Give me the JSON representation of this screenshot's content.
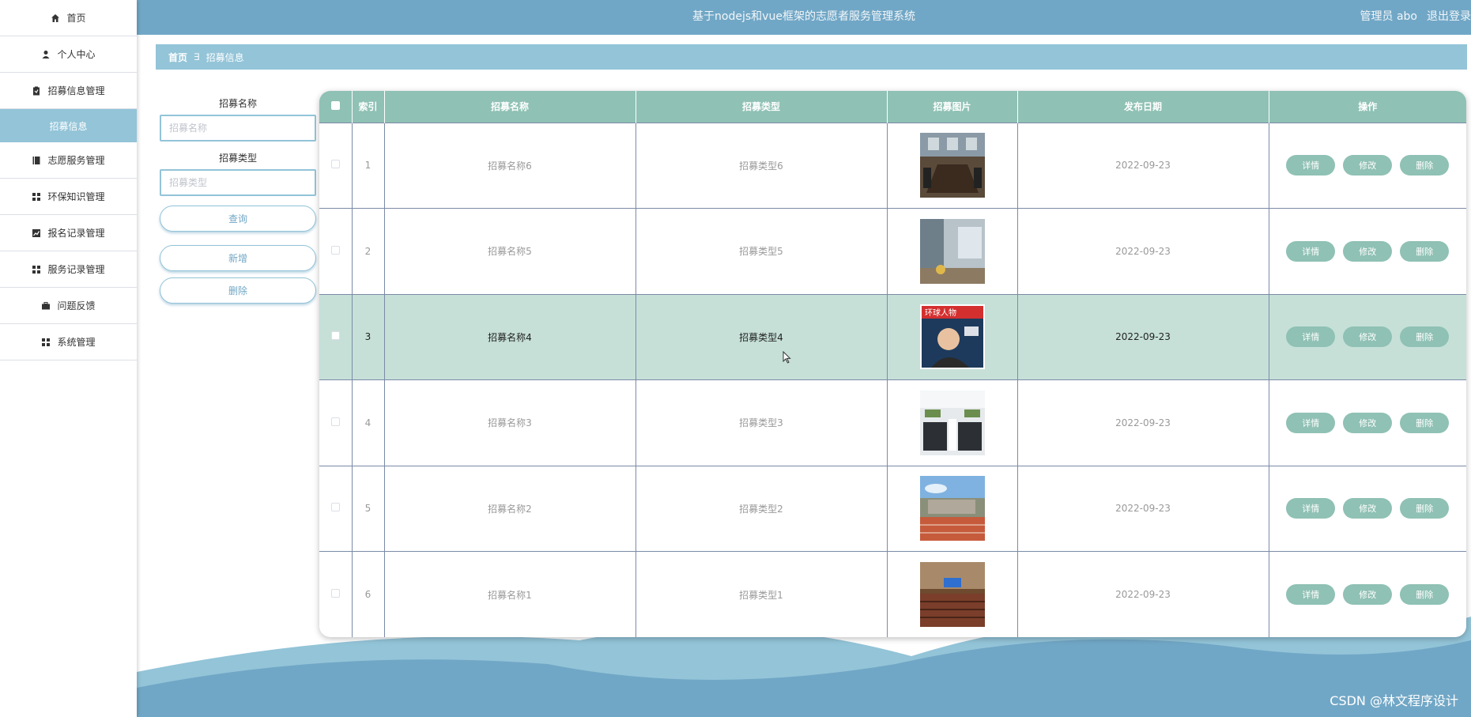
{
  "app": {
    "title": "基于nodejs和vue框架的志愿者服务管理系统",
    "user_role": "管理员",
    "username": "abo",
    "logout_label": "退出登录"
  },
  "sidebar": {
    "items": [
      {
        "label": "首页",
        "icon": "home-icon"
      },
      {
        "label": "个人中心",
        "icon": "user-icon"
      },
      {
        "label": "招募信息管理",
        "icon": "clipboard-icon"
      },
      {
        "label": "招募信息",
        "icon": "",
        "active": true
      },
      {
        "label": "志愿服务管理",
        "icon": "book-icon"
      },
      {
        "label": "环保知识管理",
        "icon": "grid-icon"
      },
      {
        "label": "报名记录管理",
        "icon": "chart-icon"
      },
      {
        "label": "服务记录管理",
        "icon": "grid-icon"
      },
      {
        "label": "问题反馈",
        "icon": "briefcase-icon"
      },
      {
        "label": "系统管理",
        "icon": "grid-icon"
      }
    ]
  },
  "breadcrumb": {
    "home": "首页",
    "separator": "∃",
    "current": "招募信息"
  },
  "search": {
    "name_label": "招募名称",
    "name_placeholder": "招募名称",
    "type_label": "招募类型",
    "type_placeholder": "招募类型",
    "query_label": "查询",
    "add_label": "新增",
    "delete_label": "删除"
  },
  "table": {
    "headers": {
      "index": "索引",
      "name": "招募名称",
      "type": "招募类型",
      "image": "招募图片",
      "date": "发布日期",
      "ops": "操作"
    },
    "op_labels": {
      "detail": "详情",
      "edit": "修改",
      "delete": "删除"
    },
    "rows": [
      {
        "index": "1",
        "name": "招募名称6",
        "type": "招募类型6",
        "date": "2022-09-23",
        "image": "meeting-room-photo"
      },
      {
        "index": "2",
        "name": "招募名称5",
        "type": "招募类型5",
        "date": "2022-09-23",
        "image": "lobby-photo"
      },
      {
        "index": "3",
        "name": "招募名称4",
        "type": "招募类型4",
        "date": "2022-09-23",
        "image": "magazine-cover-photo",
        "cover_text": "环球人物"
      },
      {
        "index": "4",
        "name": "招募名称3",
        "type": "招募类型3",
        "date": "2022-09-23",
        "image": "office-photo"
      },
      {
        "index": "5",
        "name": "招募名称2",
        "type": "招募类型2",
        "date": "2022-09-23",
        "image": "running-track-photo"
      },
      {
        "index": "6",
        "name": "招募名称1",
        "type": "招募类型1",
        "date": "2022-09-23",
        "image": "auditorium-photo"
      }
    ]
  },
  "watermark": "CSDN @林文程序设计",
  "colors": {
    "sidebar_active": "#93c4d8",
    "topbar": "#71a7c6",
    "table_header": "#8fc1b4",
    "row_hover": "#c6e0d8"
  }
}
